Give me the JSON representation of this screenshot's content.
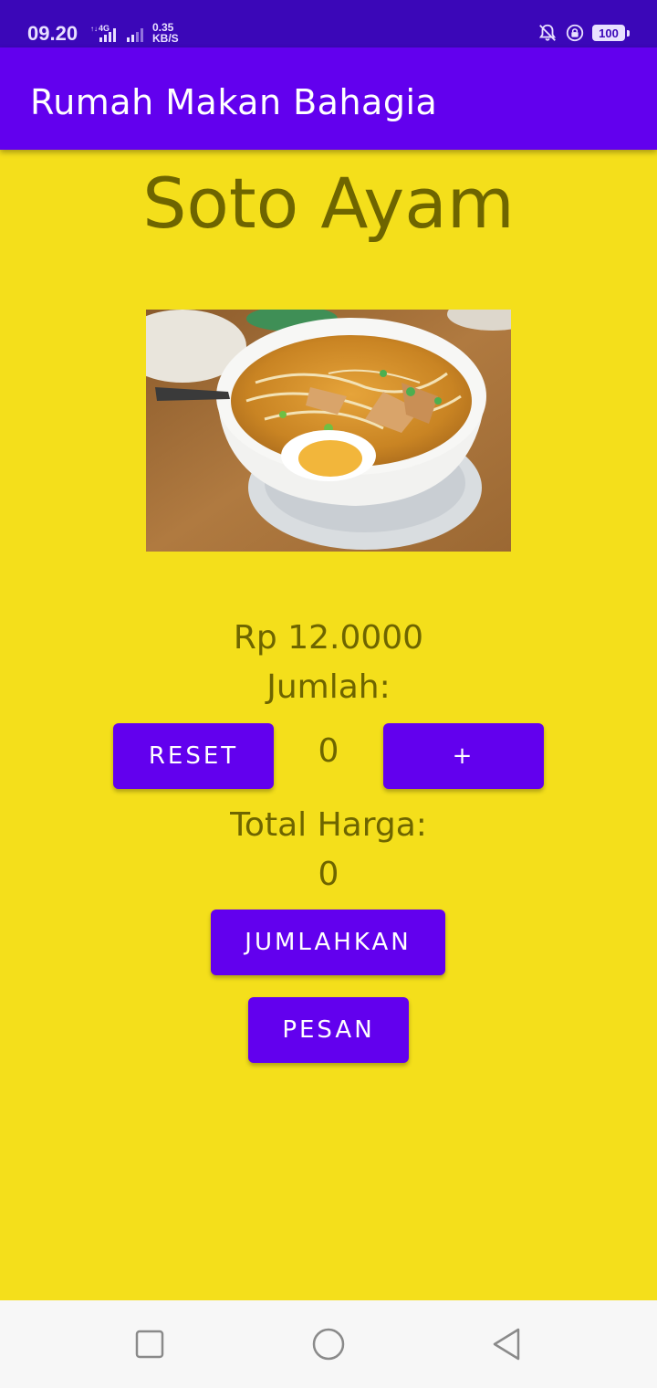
{
  "status_bar": {
    "time": "09.20",
    "network": "4G",
    "speed_value": "0.35",
    "speed_unit": "KB/S",
    "battery": "100"
  },
  "app_bar": {
    "title": "Rumah Makan Bahagia"
  },
  "main": {
    "food_title": "Soto Ayam",
    "price": "Rp 12.0000",
    "quantity_label": "Jumlah:",
    "quantity_value": "0",
    "reset_label": "RESET",
    "plus_label": "+",
    "total_label": "Total Harga:",
    "total_value": "0",
    "sum_label": "JUMLAHKAN",
    "order_label": "PESAN"
  },
  "colors": {
    "background": "#f4df1b",
    "app_bar": "#6200ee",
    "status_bar": "#3b07b8",
    "text": "#6e6500",
    "button": "#6200ee"
  },
  "icons": [
    "signal-icon",
    "bell-off-icon",
    "rotation-lock-icon",
    "battery-icon",
    "recents-icon",
    "home-icon",
    "back-icon"
  ]
}
